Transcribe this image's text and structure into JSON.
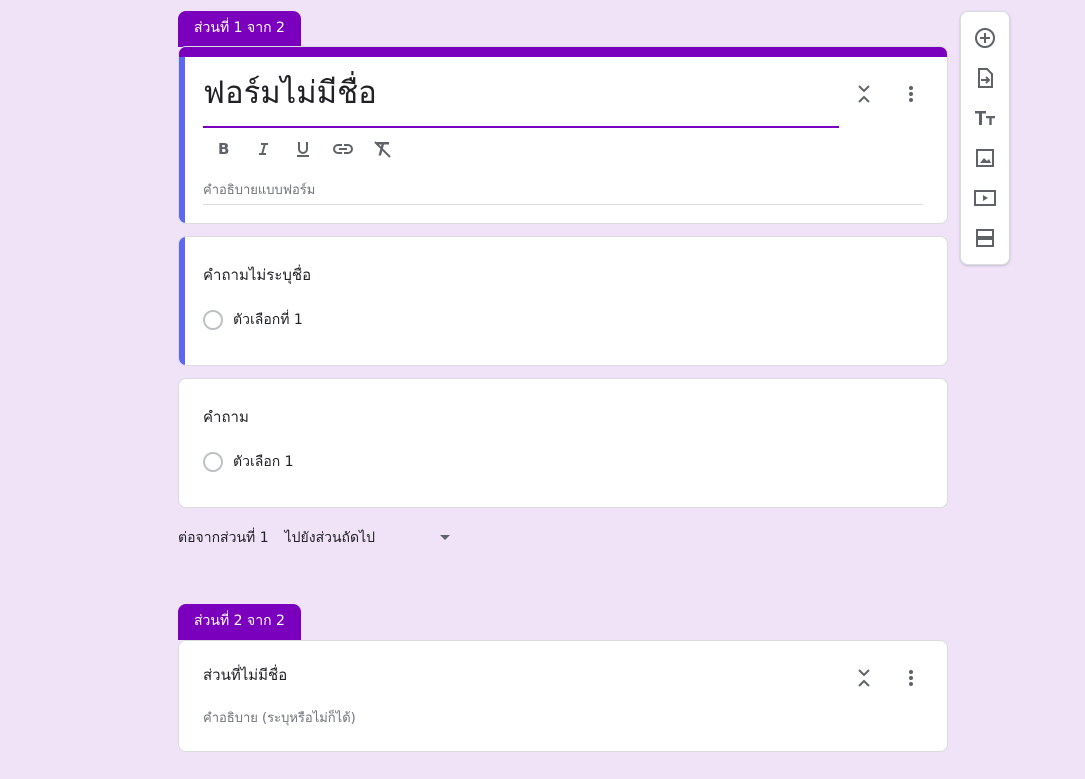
{
  "section1": {
    "tab_label": "ส่วนที่ 1 จาก 2",
    "form_title": "ฟอร์มไม่มีชื่อ",
    "description_placeholder": "คำอธิบายแบบฟอร์ม",
    "format_buttons": [
      "bold-icon",
      "italic-icon",
      "underline-icon",
      "link-icon",
      "clear-format-icon"
    ]
  },
  "question1": {
    "title": "คำถามไม่ระบุชื่อ",
    "option": "ตัวเลือกที่ 1"
  },
  "question2": {
    "title": "คำถาม",
    "option": "ตัวเลือก 1"
  },
  "after_section": {
    "label": "ต่อจากส่วนที่ 1",
    "value": "ไปยังส่วนถัดไป"
  },
  "section2": {
    "tab_label": "ส่วนที่ 2 จาก 2",
    "title": "ส่วนที่ไม่มีชื่อ",
    "description_placeholder": "คำอธิบาย (ระบุหรือไม่ก็ได้)"
  },
  "toolbar": [
    "add-question-icon",
    "import-questions-icon",
    "add-title-icon",
    "add-image-icon",
    "add-video-icon",
    "add-section-icon"
  ],
  "colors": {
    "accent": "#7b00bd",
    "active_bar": "#5c67f2",
    "background": "#f0e3f8"
  }
}
